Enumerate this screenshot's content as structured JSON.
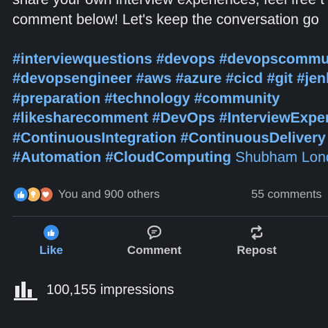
{
  "post": {
    "line1_text": "share your own interview experiences, feel free t",
    "line2_text": "comment below! Let's keep the conversation go",
    "line3_tags": "#interviewquestions #devops #devopscommun",
    "line4_tags": "#devopsengineer #aws #azure #cicd #git #jenk",
    "line5_tags": "#preparation #technology #community",
    "line6_tags": "#likesharecomment #DevOps #InterviewExperie",
    "line7_tags": "#ContinuousIntegration #ContinuousDelivery",
    "line8_tags": "#Automation #CloudComputing",
    "line8_author": "Shubham Lond"
  },
  "social": {
    "reactions_icons": [
      "like-reaction-icon",
      "insightful-reaction-icon",
      "love-reaction-icon"
    ],
    "reactions_text": "You and 900 others",
    "comments_text": "55 comments"
  },
  "actions": {
    "like_label": "Like",
    "comment_label": "Comment",
    "repost_label": "Repost"
  },
  "impressions": {
    "text": "100,155 impressions"
  },
  "colors": {
    "background": "#1b1f23",
    "link": "#71b7fb",
    "text": "#e8e9ea",
    "muted": "#b0b3b6"
  }
}
